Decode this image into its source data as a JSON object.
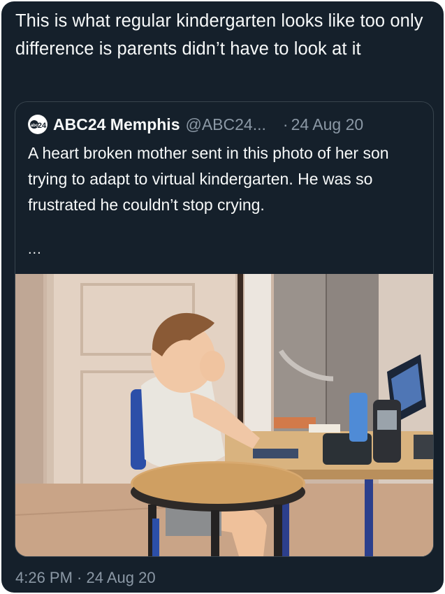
{
  "tweet": {
    "text": "This is what regular kindergarten looks like too only difference is parents didn’t have to look at it"
  },
  "quote": {
    "avatar_text": "24",
    "author_name": "ABC24 Memphis",
    "author_handle": "@ABC24...",
    "separator": "·",
    "date": "24 Aug 20",
    "text": "A heart broken mother sent in this photo of her son trying to adapt to virtual kindergarten. He was so frustrated he couldn’t stop crying.",
    "more": "..."
  },
  "footer": {
    "timestamp": "4:26 PM · 24 Aug 20"
  },
  "colors": {
    "background": "#15202b",
    "text": "#f7f9f9",
    "muted": "#8b98a5",
    "border": "#38444d"
  },
  "icons": {
    "avatar": "abc24-logo-icon"
  }
}
